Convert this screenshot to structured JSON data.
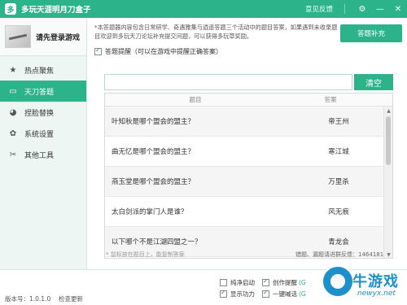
{
  "window": {
    "logo_char": "多",
    "title": "多玩天涯明月刀盒子",
    "feedback": "意见反馈",
    "settings_icon": "⚙",
    "minimize_icon": "—",
    "close_icon": "✕"
  },
  "sidebar": {
    "profile_label": "请先登录游戏",
    "items": [
      {
        "icon": "★",
        "label": "热点聚焦"
      },
      {
        "icon": "▭",
        "label": "天刀答题"
      },
      {
        "icon": "◕",
        "label": "捏脸替换"
      },
      {
        "icon": "✿",
        "label": "系统设置"
      },
      {
        "icon": "✂",
        "label": "其他工具"
      }
    ]
  },
  "main": {
    "notice": "*本答题器内容包含日常研学、奇遇雅集与逍遥答题三个活动中的题目答案，如果遇到未收录题目欢迎到多玩天刀论坛补充提交问题，可以获得多玩草奖励。",
    "open_box_button": "答题补充",
    "hint_label": "答题提醒（可以在游戏中提醒正确答案）",
    "search_placeholder": "",
    "clear_button": "清空",
    "table": {
      "headers": {
        "question": "题目",
        "answer": "答案"
      },
      "rows": [
        {
          "q": "叶知秋是哪个盟会的盟主？",
          "a": "帝王州"
        },
        {
          "q": "曲无忆是哪个盟会的盟主？",
          "a": "寒江城"
        },
        {
          "q": "燕玉堂是哪个盟会的盟主？",
          "a": "万里杀"
        },
        {
          "q": "太白剑派的掌门人是谁？",
          "a": "风无痕"
        },
        {
          "q": "以下哪个不是江湖四盟之一？",
          "a": "青龙会"
        }
      ]
    },
    "footnote_left": "* 鼠标放在题目上，能复制答案",
    "footnote_right": "错题、漏题请进群反馈：1464181"
  },
  "bottom": {
    "version": "版本号：1.0.1.0",
    "check_update": "检查更新",
    "options": [
      {
        "label": "纯净启动",
        "checked": false,
        "tag": ""
      },
      {
        "label": "创作提醒",
        "checked": true,
        "tag": "(G"
      },
      {
        "label": "显示功力",
        "checked": true,
        "tag": ""
      },
      {
        "label": "一键喊话",
        "checked": true,
        "tag": "(G"
      }
    ],
    "watermark_title": "牛游戏",
    "watermark_url": "newyx.net"
  },
  "colors": {
    "accent": "#2cb38a",
    "watermark": "#1e90c9"
  }
}
